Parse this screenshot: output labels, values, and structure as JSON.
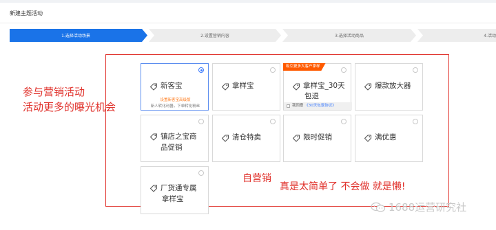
{
  "page": {
    "title": "新建主题活动"
  },
  "steps": [
    {
      "label": "1.选择活动场景",
      "active": true
    },
    {
      "label": "2.设置营销内容",
      "active": false
    },
    {
      "label": "3.选择活动商品",
      "active": false
    },
    {
      "label": "4.活动",
      "active": false
    }
  ],
  "cards": [
    {
      "label": "新客宝",
      "selected": true,
      "promo": "设置新客宝高级版",
      "note": "新人转化利器，下单转化粉丝"
    },
    {
      "label": "拿样宝",
      "selected": false
    },
    {
      "label_lines": [
        "拿样宝_30天",
        "包退"
      ],
      "selected": false,
      "ribbon": "吸引更多大客户拿样",
      "agree_text": "我同意",
      "agree_link": "《30天包退协议》"
    },
    {
      "label": "爆款放大器",
      "selected": false
    },
    {
      "label_lines": [
        "镇店之宝商",
        "品促销"
      ],
      "selected": false
    },
    {
      "label": "清仓特卖",
      "selected": false
    },
    {
      "label": "限时促销",
      "selected": false
    },
    {
      "label": "满优惠",
      "selected": false
    },
    {
      "label_lines": [
        "厂货通专属",
        "拿样宝"
      ],
      "selected": false
    }
  ],
  "annotations": {
    "side_line1": "参与营销活动",
    "side_line2": "活动更多的曝光机会",
    "self_marketing": "自营销",
    "comment": "真是太简单了  不会做  就是懒!"
  },
  "watermark": {
    "text": "1688运营研究社",
    "icon": "wechat-icon"
  },
  "colors": {
    "accent": "#1a73e8",
    "annotation": "#e0312b",
    "ribbon": "#ff5a00"
  }
}
